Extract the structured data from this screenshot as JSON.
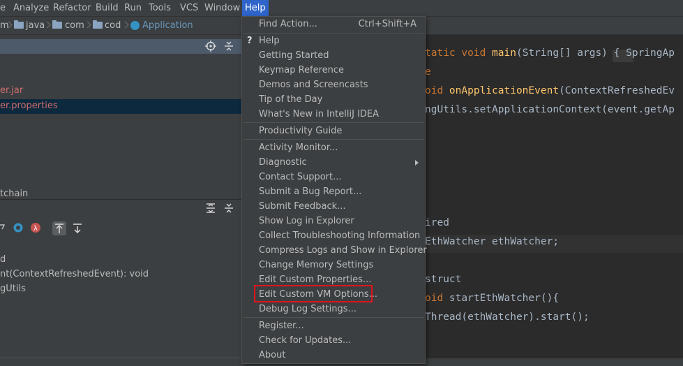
{
  "menubar": {
    "items": [
      "e",
      "Analyze",
      "Refactor",
      "Build",
      "Run",
      "Tools",
      "VCS",
      "Window",
      "Help"
    ],
    "active": "Help"
  },
  "breadcrumb": {
    "items": [
      "m",
      "java",
      "com",
      "cod",
      "Application"
    ]
  },
  "project_tree": {
    "files": [
      "er.jar",
      "er.properties"
    ],
    "other": "tchain"
  },
  "structure": {
    "items": [
      "d",
      "nt(ContextRefreshedEvent): void",
      "gUtils"
    ]
  },
  "editor": {
    "lines": [
      {
        "parts": [
          [
            "kw",
            "tatic "
          ],
          [
            "kw",
            "void "
          ],
          [
            "fn",
            "main"
          ],
          [
            "pl",
            "(String[] args) { SpringAp"
          ]
        ]
      },
      {
        "parts": [
          [
            "kw",
            "e"
          ]
        ]
      },
      {
        "parts": [
          [
            "kw",
            "oid "
          ],
          [
            "fn",
            "onApplicationEvent"
          ],
          [
            "pl",
            "(ContextRefreshedEv"
          ]
        ]
      },
      {
        "parts": [
          [
            "pl",
            "ngUtils."
          ],
          [
            "pl",
            "setApplicationContext(event.getAp"
          ]
        ]
      },
      {
        "parts": [
          [
            "pl",
            "ired"
          ]
        ]
      },
      {
        "parts": [
          [
            "pl",
            "EthWatcher ethWatcher;"
          ]
        ]
      },
      {
        "parts": [
          [
            "pl",
            "struct"
          ]
        ]
      },
      {
        "parts": [
          [
            "kw",
            "oid "
          ],
          [
            "pl",
            "startEthWatcher(){"
          ]
        ]
      },
      {
        "parts": [
          [
            "pl",
            "Thread(ethWatcher).start();"
          ]
        ]
      }
    ]
  },
  "help_menu": {
    "find_action": {
      "label": "Find Action...",
      "shortcut": "Ctrl+Shift+A"
    },
    "help": "Help",
    "help_icon": "?",
    "getting_started": "Getting Started",
    "keymap_reference": "Keymap Reference",
    "demos": "Demos and Screencasts",
    "tip_of_day": "Tip of the Day",
    "whats_new": "What's New in IntelliJ IDEA",
    "productivity_guide": "Productivity Guide",
    "activity_monitor": "Activity Monitor...",
    "diagnostic": "Diagnostic",
    "contact_support": "Contact Support...",
    "submit_bug": "Submit a Bug Report...",
    "submit_feedback": "Submit Feedback...",
    "show_log": "Show Log in Explorer",
    "collect_info": "Collect Troubleshooting Information",
    "compress_logs": "Compress Logs and Show in Explorer",
    "change_memory": "Change Memory Settings",
    "edit_custom_props": "Edit Custom Properties...",
    "edit_custom_vm": "Edit Custom VM Options...",
    "debug_log": "Debug Log Settings...",
    "register": "Register...",
    "check_updates": "Check for Updates...",
    "about": "About"
  },
  "colors": {
    "menu_bg": "#3c3f41",
    "active_menu": "#2f65ca",
    "highlight_box": "#e0141b"
  }
}
